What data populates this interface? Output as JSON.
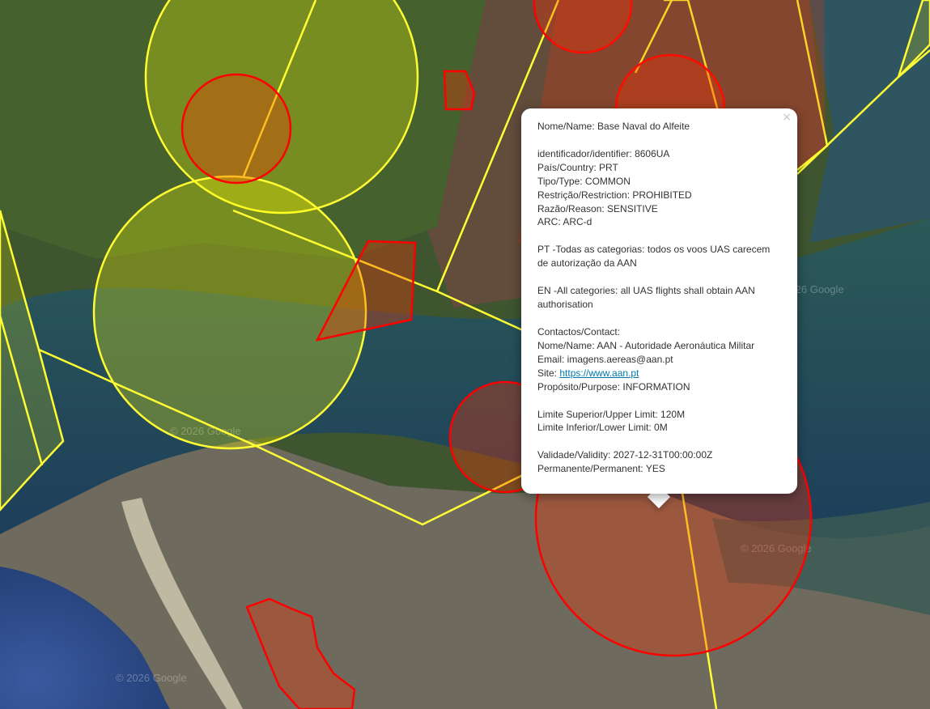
{
  "popup": {
    "close_symbol": "×",
    "name": "Nome/Name: Base Naval do Alfeite",
    "identifier": "identificador/identifier: 8606UA",
    "country": "País/Country: PRT",
    "type": "Tipo/Type: COMMON",
    "restriction": "Restrição/Restriction: PROHIBITED",
    "reason": "Razão/Reason: SENSITIVE",
    "arc": "ARC: ARC-d",
    "pt_text": "PT -Todas as categorias: todos os voos UAS carecem de autorização da AAN",
    "en_text": "EN -All categories: all UAS flights shall obtain AAN authorisation",
    "contacts_header": "Contactos/Contact:",
    "contact_name": "Nome/Name: AAN - Autoridade Aeronáutica Militar",
    "email": "Email: imagens.aereas@aan.pt",
    "site_label": "Site: ",
    "site_url": "https://www.aan.pt",
    "purpose": "Propósito/Purpose: INFORMATION",
    "upper_limit": "Limite Superior/Upper Limit: 120M",
    "lower_limit": "Limite Inferior/Lower Limit: 0M",
    "validity": "Validade/Validity: 2027-12-31T00:00:00Z",
    "permanent": "Permanente/Permanent: YES"
  },
  "map": {
    "watermarks": [
      "© 2026 Google",
      "© 2026 Google",
      "© 2026 Google",
      "© 2026 Google"
    ],
    "colors": {
      "restricted_outline": "#ffff33",
      "restricted_fill": "#ffff00",
      "prohibited_outline": "#ff0000",
      "prohibited_fill": "#ff3300"
    }
  }
}
